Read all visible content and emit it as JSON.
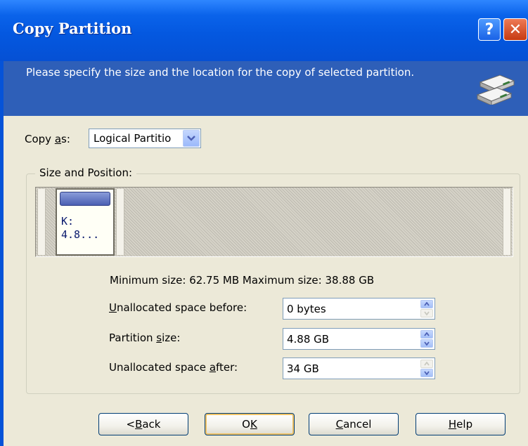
{
  "window": {
    "title": "Copy Partition",
    "colors": {
      "titlebar": "#0a63ea",
      "header_band": "#2e5fb8",
      "dialog_bg": "#ece9d8"
    }
  },
  "header": {
    "instruction": "Please specify the size and the location for the copy of selected partition.",
    "icon": "drives-icon"
  },
  "copy_as": {
    "label_prefix": "Copy ",
    "label_accel": "a",
    "label_suffix": "s:",
    "selected": "Logical Partitio"
  },
  "size_position": {
    "legend": "Size and Position:",
    "partition": {
      "line1": "K:",
      "line2": "4.8..."
    },
    "limits": "Minimum size: 62.75 MB  Maximum size: 38.88 GB"
  },
  "fields": {
    "before": {
      "accel": "U",
      "label_rest": "nallocated space before:",
      "value": "0 bytes"
    },
    "size": {
      "label_pre": "Partition ",
      "accel": "s",
      "label_rest": "ize:",
      "value": "4.88 GB"
    },
    "after": {
      "label_pre": "Unallocated space ",
      "accel": "a",
      "label_rest": "fter:",
      "value": "34 GB"
    }
  },
  "buttons": {
    "back": {
      "pre": "< ",
      "accel": "B",
      "rest": "ack"
    },
    "ok": {
      "pre": "O",
      "accel": "K",
      "rest": ""
    },
    "cancel": {
      "pre": "",
      "accel": "C",
      "rest": "ancel"
    },
    "help": {
      "pre": "",
      "accel": "H",
      "rest": "elp"
    }
  },
  "titlebar_buttons": {
    "help": "?",
    "close": "✕"
  }
}
